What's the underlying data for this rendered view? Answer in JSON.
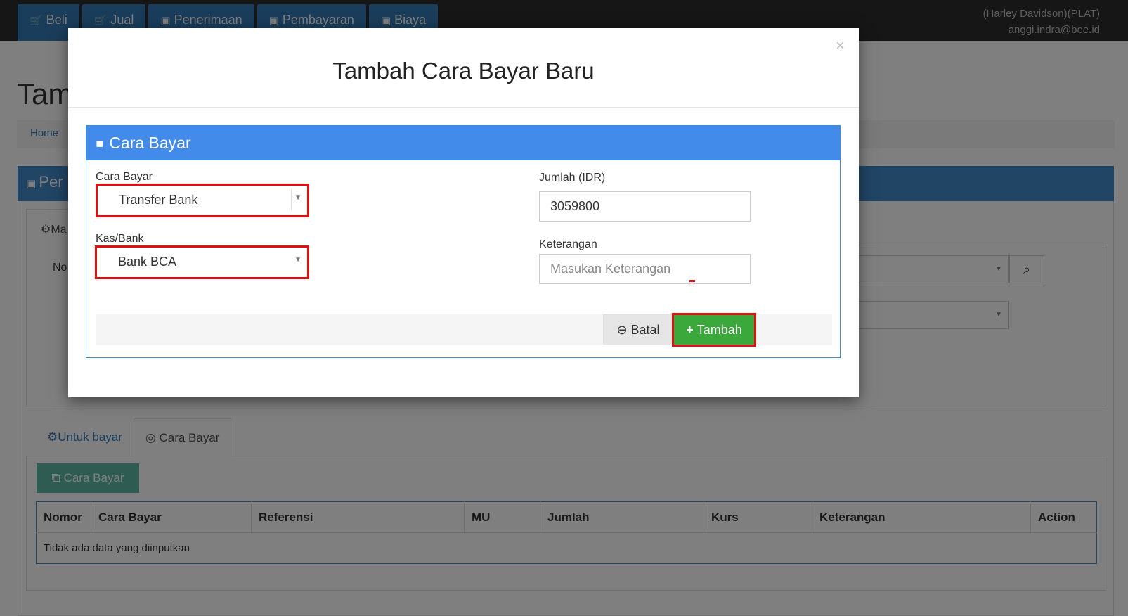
{
  "topnav": {
    "items": [
      {
        "icon": "cart-icon",
        "label": "Beli"
      },
      {
        "icon": "cart-icon",
        "label": "Jual"
      },
      {
        "icon": "money-icon",
        "label": "Penerimaan"
      },
      {
        "icon": "money-icon",
        "label": "Pembayaran"
      },
      {
        "icon": "money-icon",
        "label": "Biaya"
      }
    ],
    "company": "(Harley Davidson)(PLAT)",
    "user_email": "anggi.indra@bee.id"
  },
  "page": {
    "title": "Tam",
    "breadcrumb_home": "Home",
    "panel_title": "Per",
    "subtab_label": "Ma",
    "no_label": "No"
  },
  "bottom_tabs": [
    {
      "icon": "gears-icon",
      "label": "Untuk bayar"
    },
    {
      "icon": "check-circle-icon",
      "label": "Cara Bayar"
    }
  ],
  "cara_bayar_button": "Cara Bayar",
  "table": {
    "columns": [
      "Nomor",
      "Cara Bayar",
      "Referensi",
      "MU",
      "Jumlah",
      "Kurs",
      "Keterangan",
      "Action"
    ],
    "empty_text": "Tidak ada data yang diinputkan"
  },
  "modal": {
    "title": "Tambah Cara Bayar Baru",
    "close": "×",
    "panel_title": "Cara Bayar",
    "fields": {
      "cara_bayar_label": "Cara Bayar",
      "cara_bayar_value": "Transfer Bank",
      "kas_bank_label": "Kas/Bank",
      "kas_bank_value": "Bank BCA",
      "jumlah_label": "Jumlah (IDR)",
      "jumlah_value": "3059800",
      "keterangan_label": "Keterangan",
      "keterangan_placeholder": "Masukan Keterangan"
    },
    "buttons": {
      "batal": "Batal",
      "tambah": "Tambah"
    }
  },
  "colors": {
    "primary": "#428bca",
    "success": "#3aa83a",
    "highlight": "#e01010",
    "topbar": "#2c2c2c"
  }
}
